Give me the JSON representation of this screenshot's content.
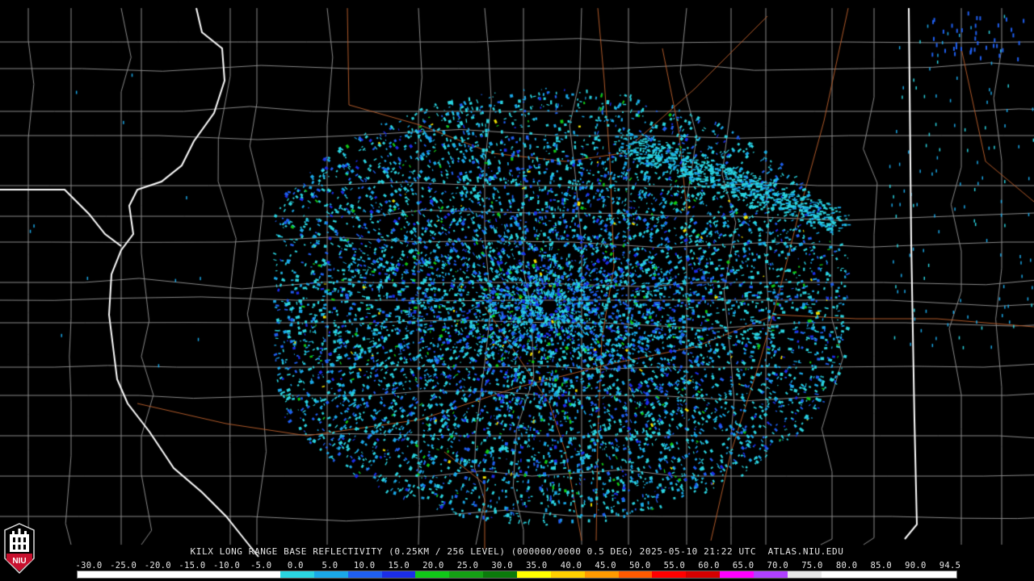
{
  "product": {
    "station": "KILX",
    "caption": "KILX LONG RANGE BASE REFLECTIVITY (0.25KM / 256 LEVEL) (000000/0000 0.5 DEG) 2025-05-10 21:22 UTC  ATLAS.NIU.EDU",
    "timestamp": "2025-05-10 21:22 UTC",
    "source": "ATLAS.NIU.EDU"
  },
  "logo": {
    "text": "NIU",
    "colors": {
      "red": "#c8102e",
      "white": "#ffffff",
      "black": "#000000"
    }
  },
  "scale": {
    "labels": [
      "-30.0",
      "-25.0",
      "-20.0",
      "-15.0",
      "-10.0",
      "-5.0",
      "0.0",
      "5.0",
      "10.0",
      "15.0",
      "20.0",
      "25.0",
      "30.0",
      "35.0",
      "40.0",
      "45.0",
      "50.0",
      "55.0",
      "60.0",
      "65.0",
      "70.0",
      "75.0",
      "80.0",
      "85.0",
      "90.0",
      "94.5"
    ],
    "unit_min": -30.0,
    "unit_max": 94.5,
    "colors": [
      "#ffffff",
      "#ffffff",
      "#ffffff",
      "#ffffff",
      "#ffffff",
      "#ffffff",
      "#2ad4e0",
      "#1aa8e8",
      "#1f5ff0",
      "#1b2de8",
      "#10c818",
      "#14a014",
      "#0b7a0b",
      "#ffff00",
      "#ffd000",
      "#ff9a00",
      "#ff5a00",
      "#ff0000",
      "#d40000",
      "#ff00ff",
      "#b040ff",
      "#e8e8e8",
      "#ffffff",
      "#ffffff",
      "#ffffff",
      "#ffffff"
    ]
  },
  "map": {
    "background": "#000000",
    "county_line_color": "#8a8a8a",
    "state_line_color": "#ffffff",
    "road_color": "#b05a2a",
    "radar_center_label": "KILX"
  }
}
